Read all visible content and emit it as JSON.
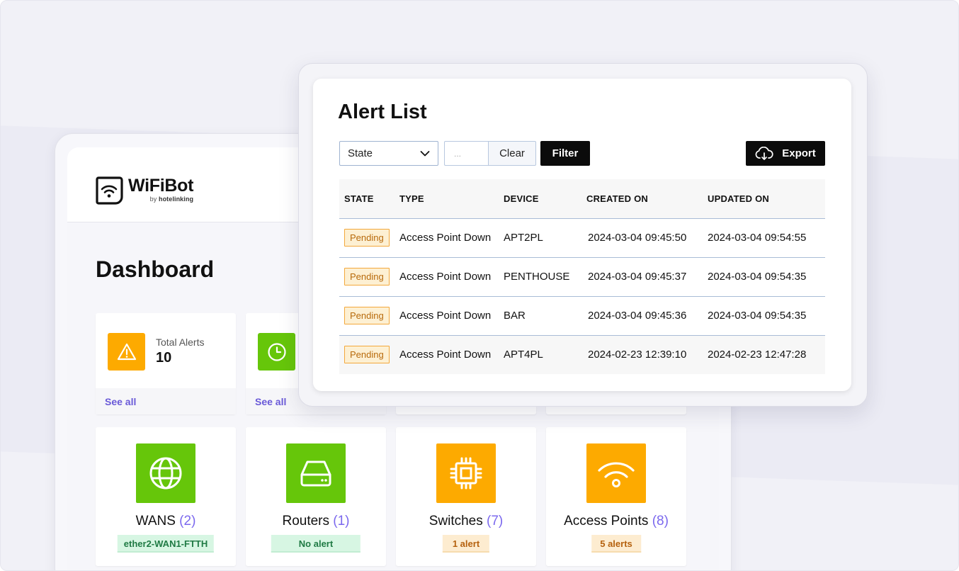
{
  "dashboard": {
    "logo": {
      "name": "WiFiBot",
      "by_prefix": "by",
      "by_brand": "hotelinking"
    },
    "title": "Dashboard",
    "stats": [
      {
        "label": "Total Alerts",
        "value": "10",
        "link": "See all",
        "icon": "warning-icon",
        "color": "#fdaa00"
      },
      {
        "label": "",
        "value": "",
        "link": "See all",
        "icon": "clock-icon",
        "color": "#66c60a"
      }
    ],
    "devices": [
      {
        "name": "WANS",
        "count": "(2)",
        "badge": "ether2-WAN1-FTTH",
        "badge_style": "green",
        "icon": "globe-icon",
        "color": "#66c60a"
      },
      {
        "name": "Routers",
        "count": "(1)",
        "badge": "No alert",
        "badge_style": "green",
        "icon": "router-icon",
        "color": "#66c60a"
      },
      {
        "name": "Switches",
        "count": "(7)",
        "badge": "1 alert",
        "badge_style": "orange",
        "icon": "chip-icon",
        "color": "#fdaa00"
      },
      {
        "name": "Access Points",
        "count": "(8)",
        "badge": "5 alerts",
        "badge_style": "orange",
        "icon": "wifi-icon",
        "color": "#fdaa00"
      }
    ]
  },
  "alert_list": {
    "title": "Alert List",
    "filters": {
      "state_select": "State",
      "date_placeholder": "...",
      "clear_label": "Clear",
      "filter_label": "Filter",
      "export_label": "Export"
    },
    "columns": [
      "STATE",
      "TYPE",
      "DEVICE",
      "CREATED ON",
      "UPDATED ON"
    ],
    "rows": [
      {
        "state": "Pending",
        "type": "Access Point Down",
        "device": "APT2PL",
        "created": "2024-03-04 09:45:50",
        "updated": "2024-03-04 09:54:55"
      },
      {
        "state": "Pending",
        "type": "Access Point Down",
        "device": "PENTHOUSE",
        "created": "2024-03-04 09:45:37",
        "updated": "2024-03-04 09:54:35"
      },
      {
        "state": "Pending",
        "type": "Access Point Down",
        "device": "BAR",
        "created": "2024-03-04 09:45:36",
        "updated": "2024-03-04 09:54:35"
      },
      {
        "state": "Pending",
        "type": "Access Point Down",
        "device": "APT4PL",
        "created": "2024-02-23 12:39:10",
        "updated": "2024-02-23 12:47:28"
      }
    ]
  },
  "colors": {
    "accent_purple": "#7b68ee",
    "green": "#66c60a",
    "orange": "#fdaa00",
    "pending_text": "#b86a0b"
  }
}
